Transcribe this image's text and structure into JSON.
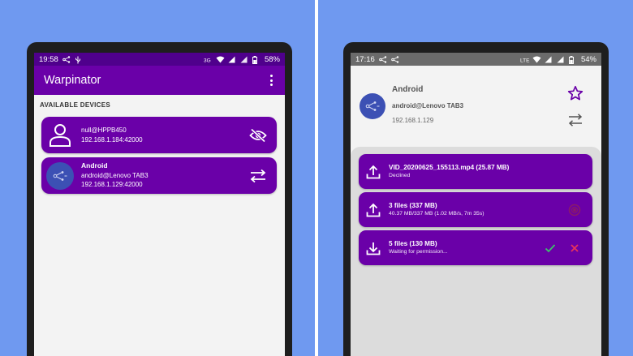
{
  "left": {
    "status": {
      "time": "19:58",
      "battery": "58%"
    },
    "app": {
      "title": "Warpinator"
    },
    "section_label": "AVAILABLE DEVICES",
    "devices": [
      {
        "line1": "null@HPPB450",
        "line2": "192.168.1.184:42000"
      },
      {
        "name": "Android",
        "line1": "android@Lenovo TAB3",
        "line2": "192.168.1.129:42000"
      }
    ]
  },
  "right": {
    "status": {
      "time": "17:16",
      "battery": "54%"
    },
    "device": {
      "name": "Android",
      "host": "android@Lenovo TAB3",
      "ip": "192.168.1.129"
    },
    "transfers": [
      {
        "title": "VID_20200625_155113.mp4 (25.87 MB)",
        "subtitle": "Declined",
        "direction": "upload"
      },
      {
        "title": "3 files (337 MB)",
        "subtitle": "40.37 MB/337 MB (1.02 MB/s, 7m 35s)",
        "direction": "upload"
      },
      {
        "title": "5 files (130 MB)",
        "subtitle": "Waiting for permission...",
        "direction": "download"
      }
    ]
  },
  "colors": {
    "accent": "#6a00a8",
    "statusbar": "#4f008c",
    "background": "#6f99f0",
    "avatar": "#3c50b4",
    "cancel_accent": "#e8335a",
    "accept_accent": "#3cc36a"
  }
}
